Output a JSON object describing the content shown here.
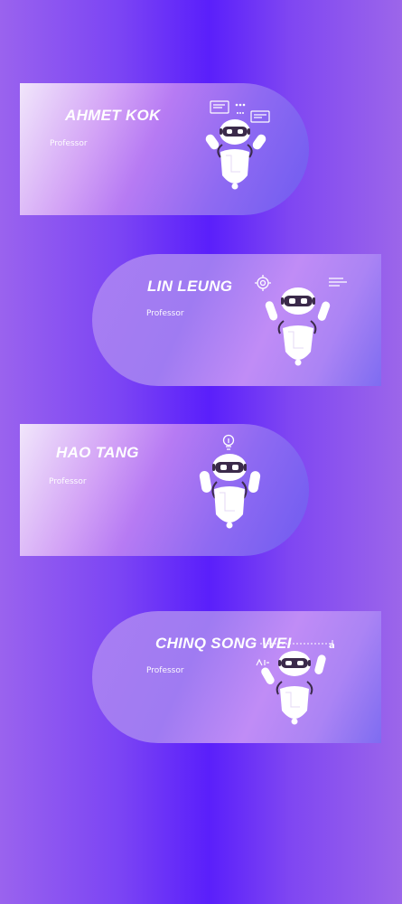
{
  "cards": [
    {
      "name": "AHMET KOK",
      "role": "Professor"
    },
    {
      "name": "LIN LEUNG",
      "role": "Professor"
    },
    {
      "name": "HAO TANG",
      "role": "Professor"
    },
    {
      "name": "CHINQ SONG WEI",
      "role": "Professor"
    }
  ],
  "robot_icons": [
    "chat-bubbles-icon",
    "gear-icon",
    "lightbulb-icon",
    "translate-icon"
  ]
}
